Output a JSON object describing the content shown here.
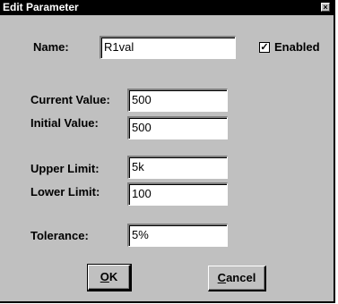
{
  "window": {
    "title": "Edit Parameter",
    "close_glyph": "×"
  },
  "name": {
    "label": "Name:",
    "value": "R1val"
  },
  "enabled": {
    "label": "Enabled",
    "checked": true,
    "check_glyph": "✓"
  },
  "current_value": {
    "label": "Current Value:",
    "value": "500"
  },
  "initial_value": {
    "label": "Initial Value:",
    "value": "500"
  },
  "upper_limit": {
    "label": "Upper Limit:",
    "value": "5k"
  },
  "lower_limit": {
    "label": "Lower Limit:",
    "value": "100"
  },
  "tolerance": {
    "label": "Tolerance:",
    "value": "5%"
  },
  "buttons": {
    "ok": {
      "mnemonic": "O",
      "rest": "K"
    },
    "cancel": {
      "mnemonic": "C",
      "rest": "ancel"
    }
  }
}
